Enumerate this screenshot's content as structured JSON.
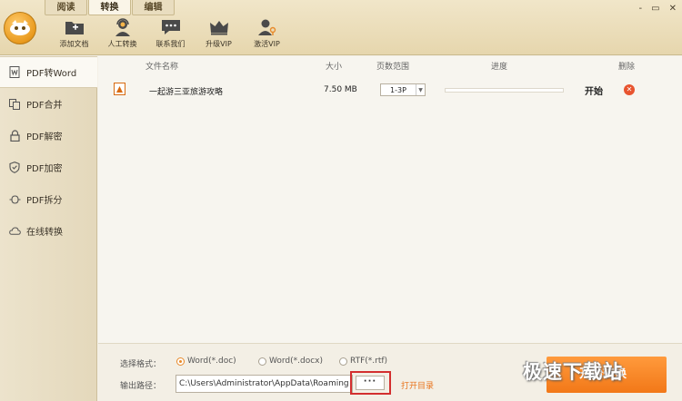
{
  "tabs": [
    {
      "label": "阅读",
      "active": false
    },
    {
      "label": "转换",
      "active": true
    },
    {
      "label": "编辑",
      "active": false
    }
  ],
  "toolbar": [
    {
      "label": "添加文档",
      "icon": "folder-add-icon"
    },
    {
      "label": "人工转换",
      "icon": "support-agent-icon"
    },
    {
      "label": "联系我们",
      "icon": "chat-icon"
    },
    {
      "label": "升级VIP",
      "icon": "crown-icon"
    },
    {
      "label": "激活VIP",
      "icon": "user-key-icon"
    }
  ],
  "window_controls": [
    "-",
    "▭",
    "✕"
  ],
  "sidebar": [
    {
      "label": "PDF转Word",
      "icon": "word-doc-icon",
      "active": true
    },
    {
      "label": "PDF合并",
      "icon": "merge-icon",
      "active": false
    },
    {
      "label": "PDF解密",
      "icon": "lock-icon",
      "active": false
    },
    {
      "label": "PDF加密",
      "icon": "shield-icon",
      "active": false
    },
    {
      "label": "PDF拆分",
      "icon": "split-icon",
      "active": false
    },
    {
      "label": "在线转换",
      "icon": "cloud-icon",
      "active": false
    }
  ],
  "table": {
    "headers": [
      "文件名称",
      "大小",
      "页数范围",
      "进度",
      "删除"
    ],
    "rows": [
      {
        "name": "一起游三亚旅游攻略",
        "size": "7.50 MB",
        "range": "1-3P",
        "progress": 0,
        "action": "开始"
      }
    ]
  },
  "footer": {
    "format_label": "选择格式：",
    "formats": [
      {
        "label": "Word(*.doc)",
        "checked": true
      },
      {
        "label": "Word(*.docx)",
        "checked": false
      },
      {
        "label": "RTF(*.rtf)",
        "checked": false
      }
    ],
    "path_label": "输出路径：",
    "path_value": "C:\\Users\\Administrator\\AppData\\Roaming",
    "browse_label": "···",
    "open_dir_label": "打开目录",
    "start_label": "开始转换"
  },
  "watermark": "极速下载站",
  "colors": {
    "accent": "#f27818",
    "highlight_box": "#d32f2f",
    "delete": "#e8542f"
  }
}
